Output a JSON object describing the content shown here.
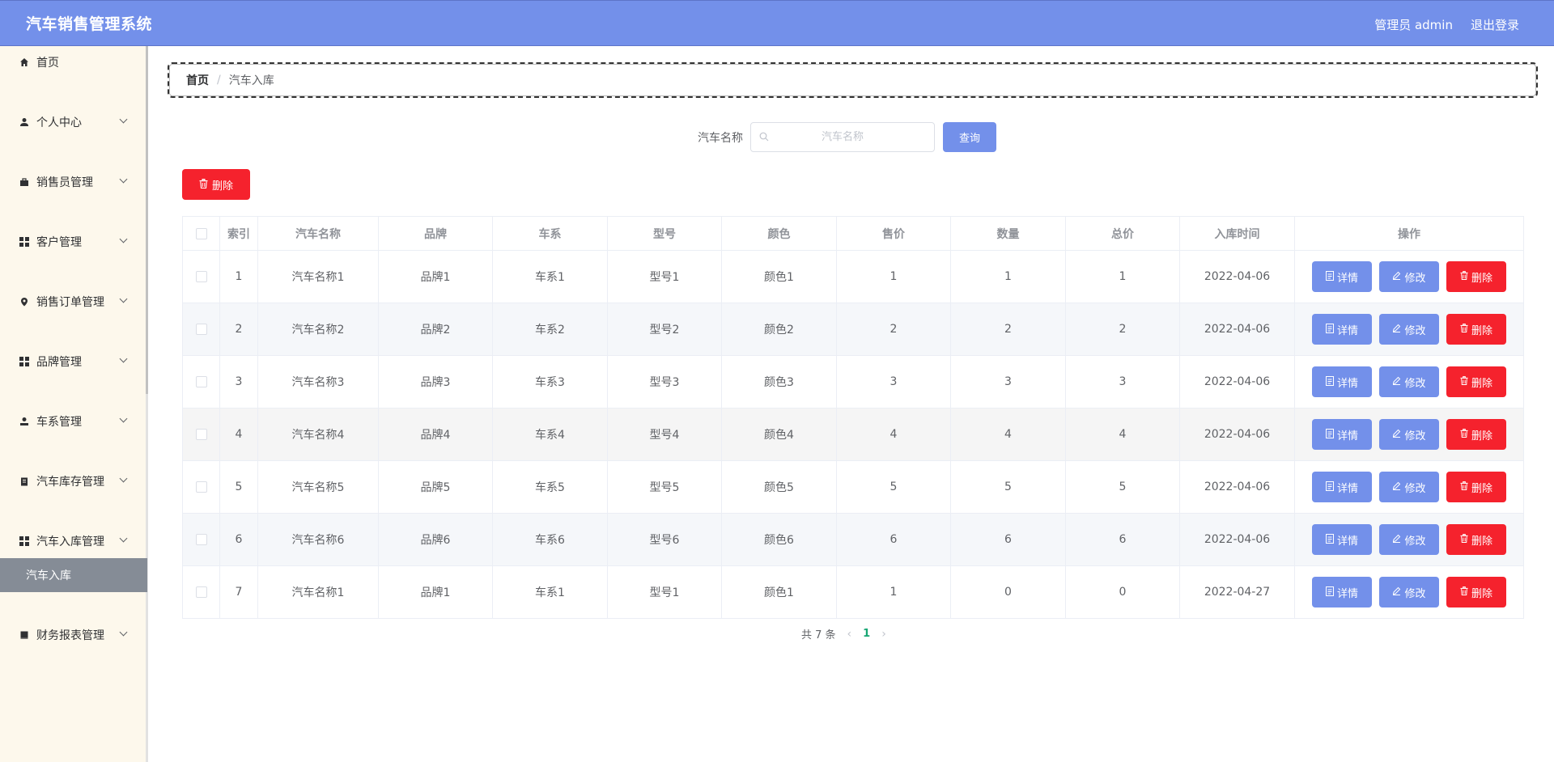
{
  "header": {
    "title": "汽车销售管理系统",
    "user": "管理员 admin",
    "logout": "退出登录"
  },
  "sidebar": {
    "items": [
      {
        "label": "首页",
        "icon": "home-icon"
      },
      {
        "label": "个人中心",
        "icon": "user-icon"
      },
      {
        "label": "销售员管理",
        "icon": "briefcase-icon"
      },
      {
        "label": "客户管理",
        "icon": "grid-icon"
      },
      {
        "label": "销售订单管理",
        "icon": "location-icon"
      },
      {
        "label": "品牌管理",
        "icon": "grid-icon"
      },
      {
        "label": "车系管理",
        "icon": "user-icon"
      },
      {
        "label": "汽车库存管理",
        "icon": "clipboard-icon"
      },
      {
        "label": "汽车入库管理",
        "icon": "grid-icon"
      },
      {
        "label": "财务报表管理",
        "icon": "book-icon"
      }
    ],
    "active_sub": "汽车入库"
  },
  "breadcrumb": {
    "home": "首页",
    "sep": "/",
    "current": "汽车入库"
  },
  "search": {
    "label": "汽车名称",
    "placeholder": "汽车名称",
    "button": "查询"
  },
  "toolbar": {
    "delete": "删除"
  },
  "table": {
    "headers": [
      "索引",
      "汽车名称",
      "品牌",
      "车系",
      "型号",
      "颜色",
      "售价",
      "数量",
      "总价",
      "入库时间",
      "操作"
    ],
    "rows": [
      {
        "index": "1",
        "name": "汽车名称1",
        "brand": "品牌1",
        "series": "车系1",
        "model": "型号1",
        "color": "颜色1",
        "price": "1",
        "qty": "1",
        "total": "1",
        "time": "2022-04-06"
      },
      {
        "index": "2",
        "name": "汽车名称2",
        "brand": "品牌2",
        "series": "车系2",
        "model": "型号2",
        "color": "颜色2",
        "price": "2",
        "qty": "2",
        "total": "2",
        "time": "2022-04-06"
      },
      {
        "index": "3",
        "name": "汽车名称3",
        "brand": "品牌3",
        "series": "车系3",
        "model": "型号3",
        "color": "颜色3",
        "price": "3",
        "qty": "3",
        "total": "3",
        "time": "2022-04-06"
      },
      {
        "index": "4",
        "name": "汽车名称4",
        "brand": "品牌4",
        "series": "车系4",
        "model": "型号4",
        "color": "颜色4",
        "price": "4",
        "qty": "4",
        "total": "4",
        "time": "2022-04-06"
      },
      {
        "index": "5",
        "name": "汽车名称5",
        "brand": "品牌5",
        "series": "车系5",
        "model": "型号5",
        "color": "颜色5",
        "price": "5",
        "qty": "5",
        "total": "5",
        "time": "2022-04-06"
      },
      {
        "index": "6",
        "name": "汽车名称6",
        "brand": "品牌6",
        "series": "车系6",
        "model": "型号6",
        "color": "颜色6",
        "price": "6",
        "qty": "6",
        "total": "6",
        "time": "2022-04-06"
      },
      {
        "index": "7",
        "name": "汽车名称1",
        "brand": "品牌1",
        "series": "车系1",
        "model": "型号1",
        "color": "颜色1",
        "price": "1",
        "qty": "0",
        "total": "0",
        "time": "2022-04-27"
      }
    ],
    "actions": {
      "detail": "详情",
      "edit": "修改",
      "delete": "删除"
    }
  },
  "pagination": {
    "total_text": "共 7 条",
    "current": "1"
  },
  "colors": {
    "primary": "#7390ea",
    "danger": "#f5222d",
    "sidebar_bg": "#fdf8ec",
    "active_sub_bg": "#858c96",
    "page_active": "#17a673"
  }
}
